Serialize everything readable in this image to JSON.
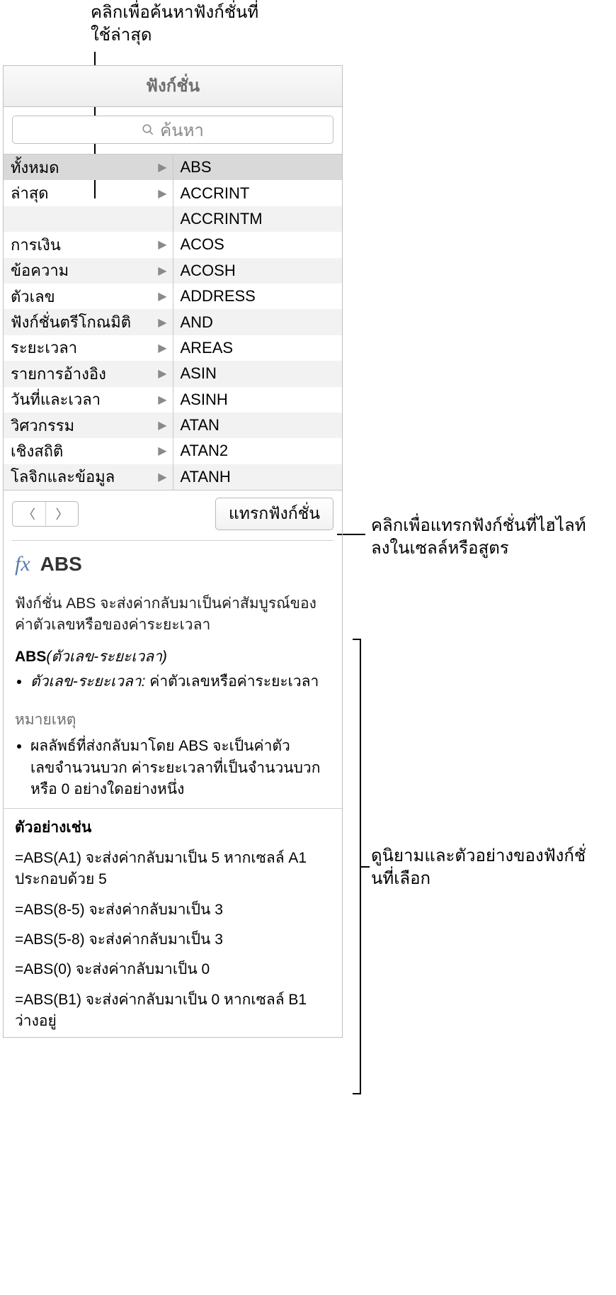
{
  "callouts": {
    "top": "คลิกเพื่อค้นหาฟังก์ชั่นที่ใช้ล่าสุด",
    "insert": "คลิกเพื่อแทรกฟังก์ชั่นที่ไฮไลท์ลงในเซลล์หรือสูตร",
    "detail": "ดูนิยามและตัวอย่างของฟังก์ชั่นที่เลือก"
  },
  "header": {
    "title": "ฟังก์ชั่น"
  },
  "search": {
    "placeholder": "ค้นหา"
  },
  "categories": [
    "ทั้งหมด",
    "ล่าสุด",
    "",
    "การเงิน",
    "ข้อความ",
    "ตัวเลข",
    "ฟังก์ชั่นตรีโกณมิติ",
    "ระยะเวลา",
    "รายการอ้างอิง",
    "วันที่และเวลา",
    "วิศวกรรม",
    "เชิงสถิติ",
    "โลจิกและข้อมูล"
  ],
  "functions": [
    "ABS",
    "ACCRINT",
    "ACCRINTM",
    "ACOS",
    "ACOSH",
    "ADDRESS",
    "AND",
    "AREAS",
    "ASIN",
    "ASINH",
    "ATAN",
    "ATAN2",
    "ATANH"
  ],
  "nav": {
    "insert_label": "แทรกฟังก์ชั่น"
  },
  "detail": {
    "fx": "fx",
    "name": "ABS",
    "desc": "ฟังก์ชั่น ABS จะส่งค่ากลับมาเป็นค่าสัมบูรณ์ของค่าตัวเลขหรือของค่าระยะเวลา",
    "syntax_fn": "ABS",
    "syntax_arg": "(ตัวเลข-ระยะเวลา)",
    "arg_name": "ตัวเลข-ระยะเวลา:",
    "arg_desc": " ค่าตัวเลขหรือค่าระยะเวลา",
    "notes_h": "หมายเหตุ",
    "note1": "ผลลัพธ์ที่ส่งกลับมาโดย ABS จะเป็นค่าตัวเลขจำนวนบวก ค่าระยะเวลาที่เป็นจำนวนบวก หรือ 0 อย่างใดอย่างหนึ่ง",
    "ex_h": "ตัวอย่างเช่น",
    "ex1": "=ABS(A1) จะส่งค่ากลับมาเป็น 5 หากเซลล์ A1 ประกอบด้วย 5",
    "ex2": "=ABS(8-5) จะส่งค่ากลับมาเป็น 3",
    "ex3": "=ABS(5-8) จะส่งค่ากลับมาเป็น 3",
    "ex4": "=ABS(0) จะส่งค่ากลับมาเป็น 0",
    "ex5": "=ABS(B1) จะส่งค่ากลับมาเป็น 0 หากเซลล์ B1 ว่างอยู่"
  }
}
